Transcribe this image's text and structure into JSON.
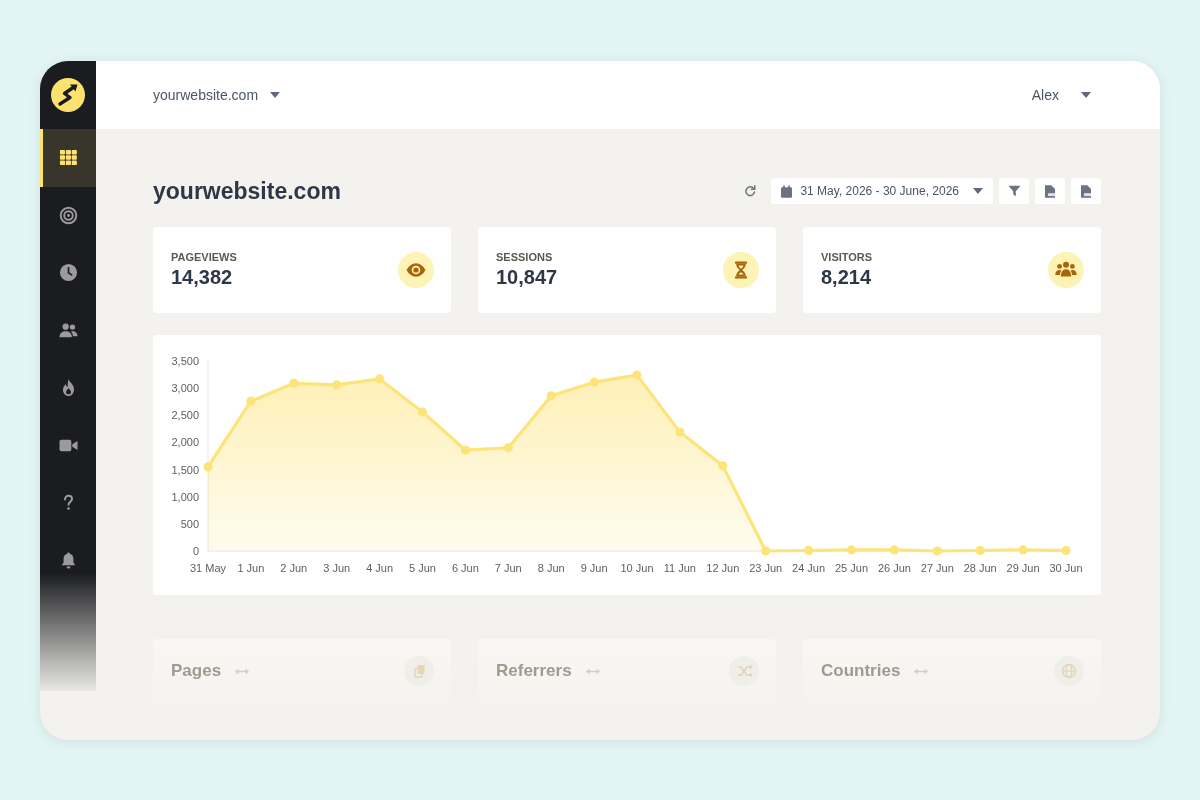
{
  "sidebar": {
    "items": [
      {
        "selected": true
      },
      {
        "selected": false
      },
      {
        "selected": false
      },
      {
        "selected": false
      },
      {
        "selected": false
      },
      {
        "selected": false
      },
      {
        "selected": false
      },
      {
        "selected": false
      }
    ]
  },
  "header": {
    "site_selector": "yourwebsite.com",
    "user_menu": "Alex"
  },
  "page": {
    "title": "yourwebsite.com",
    "date_range": "31 May, 2026 - 30 June, 2026"
  },
  "stats": [
    {
      "label": "PAGEVIEWS",
      "value": "14,382"
    },
    {
      "label": "SESSIONS",
      "value": "10,847"
    },
    {
      "label": "VISITORS",
      "value": "8,214"
    }
  ],
  "chart": {
    "chart_data": {
      "type": "area",
      "categories": [
        "31 May",
        "1 Jun",
        "2 Jun",
        "3 Jun",
        "4 Jun",
        "5 Jun",
        "6 Jun",
        "7 Jun",
        "8 Jun",
        "9 Jun",
        "10 Jun",
        "11 Jun",
        "12 Jun",
        "23 Jun",
        "24 Jun",
        "25 Jun",
        "26 Jun",
        "27 Jun",
        "28 Jun",
        "29 Jun",
        "30 Jun"
      ],
      "series": [
        {
          "color": "#fde47a",
          "values": [
            1550,
            2760,
            3090,
            3060,
            3170,
            2560,
            1860,
            1900,
            2860,
            3110,
            3240,
            2190,
            1570,
            0,
            10,
            20,
            20,
            0,
            10,
            20,
            10
          ]
        }
      ],
      "ylim": [
        0,
        3500
      ],
      "yticks": [
        {
          "value": 0,
          "label": "0"
        },
        {
          "value": 500,
          "label": "500"
        },
        {
          "value": 1000,
          "label": "1,000"
        },
        {
          "value": 1500,
          "label": "1,500"
        },
        {
          "value": 2000,
          "label": "2,000"
        },
        {
          "value": 2500,
          "label": "2,500"
        },
        {
          "value": 3000,
          "label": "3,000"
        },
        {
          "value": 3500,
          "label": "3,500"
        }
      ]
    }
  },
  "panels": [
    {
      "title": "Pages"
    },
    {
      "title": "Referrers"
    },
    {
      "title": "Countries"
    }
  ]
}
